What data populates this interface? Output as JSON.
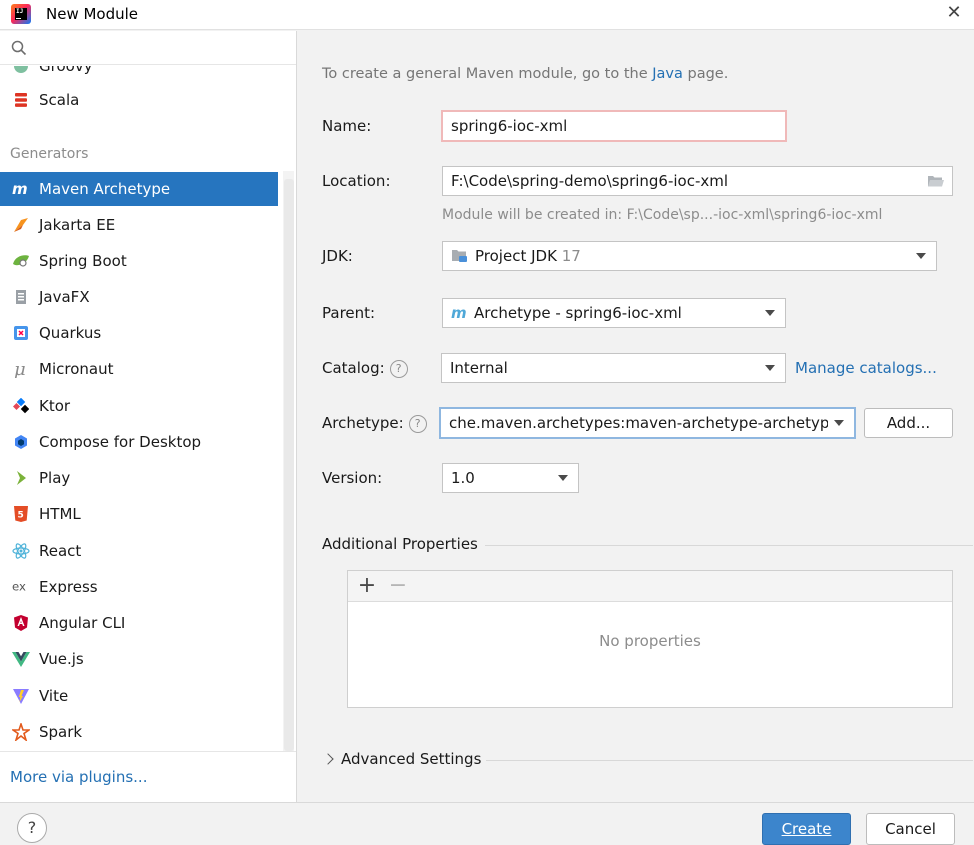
{
  "window": {
    "title": "New Module"
  },
  "sidebar": {
    "search_placeholder": "",
    "partial_item": "Groovy",
    "items_top": [
      {
        "label": "Scala",
        "icon": "scala-icon"
      }
    ],
    "section_header": "Generators",
    "generators": [
      {
        "label": "Maven Archetype",
        "icon": "maven-icon",
        "selected": true
      },
      {
        "label": "Jakarta EE",
        "icon": "jakarta-icon"
      },
      {
        "label": "Spring Boot",
        "icon": "spring-boot-icon"
      },
      {
        "label": "JavaFX",
        "icon": "javafx-icon"
      },
      {
        "label": "Quarkus",
        "icon": "quarkus-icon"
      },
      {
        "label": "Micronaut",
        "icon": "micronaut-icon"
      },
      {
        "label": "Ktor",
        "icon": "ktor-icon"
      },
      {
        "label": "Compose for Desktop",
        "icon": "compose-icon"
      },
      {
        "label": "Play",
        "icon": "play-icon"
      },
      {
        "label": "HTML",
        "icon": "html5-icon"
      },
      {
        "label": "React",
        "icon": "react-icon"
      },
      {
        "label": "Express",
        "icon": "express-icon"
      },
      {
        "label": "Angular CLI",
        "icon": "angular-icon"
      },
      {
        "label": "Vue.js",
        "icon": "vue-icon"
      },
      {
        "label": "Vite",
        "icon": "vite-icon"
      },
      {
        "label": "Spark",
        "icon": "spark-icon"
      }
    ],
    "more_plugins": "More via plugins..."
  },
  "form": {
    "hint_prefix": "To create a general Maven module, go to the ",
    "hint_link": "Java",
    "hint_suffix": " page.",
    "name_label": "Name:",
    "name_value": "spring6-ioc-xml",
    "location_label": "Location:",
    "location_value": "F:\\Code\\spring-demo\\spring6-ioc-xml",
    "location_note": "Module will be created in: F:\\Code\\sp...-ioc-xml\\spring6-ioc-xml",
    "jdk_label": "JDK:",
    "jdk_value": "Project JDK",
    "jdk_version": "17",
    "parent_label": "Parent:",
    "parent_value": "Archetype - spring6-ioc-xml",
    "catalog_label": "Catalog:",
    "catalog_value": "Internal",
    "manage_catalogs": "Manage catalogs...",
    "archetype_label": "Archetype:",
    "archetype_value": "che.maven.archetypes:maven-archetype-archetype",
    "add_button": "Add...",
    "version_label": "Version:",
    "version_value": "1.0",
    "additional_properties": "Additional Properties",
    "add_symbol": "+",
    "remove_symbol": "−",
    "no_properties": "No properties",
    "advanced_settings": "Advanced Settings"
  },
  "footer": {
    "help": "?",
    "create": "Create",
    "cancel": "Cancel"
  },
  "colors": {
    "selection": "#2675bf",
    "primary_button": "#3c85cc",
    "link": "#2470b3",
    "error_border": "#f0b9b9"
  }
}
